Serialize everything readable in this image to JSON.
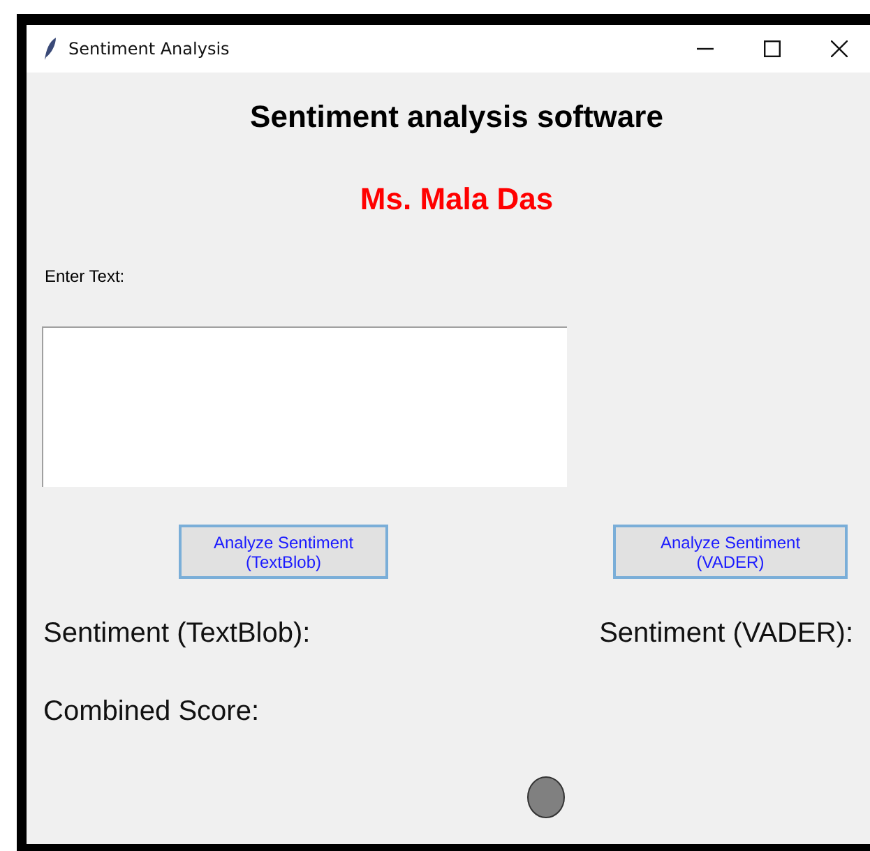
{
  "window": {
    "title": "Sentiment Analysis"
  },
  "heading": "Sentiment analysis software",
  "author": "Ms. Mala Das",
  "input": {
    "label": "Enter Text:"
  },
  "buttons": [
    "Analyze Sentiment (TextBlob)",
    "Analyze Sentiment (VADER)"
  ],
  "results": [
    "Sentiment (TextBlob):",
    "Sentiment (VADER):"
  ],
  "combined_score": "Combined Score:"
}
